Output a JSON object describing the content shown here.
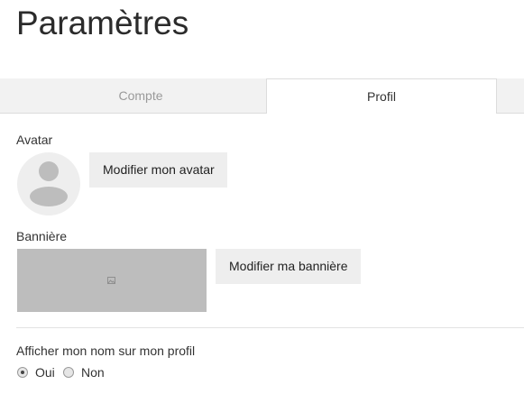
{
  "page": {
    "title": "Paramètres"
  },
  "tabs": [
    {
      "label": "Compte",
      "active": false
    },
    {
      "label": "Profil",
      "active": true
    }
  ],
  "avatar_section": {
    "label": "Avatar",
    "button_label": "Modifier mon avatar",
    "icon": "user-silhouette-icon"
  },
  "banner_section": {
    "label": "Bannière",
    "button_label": "Modifier ma bannière",
    "icon": "image-placeholder-icon"
  },
  "show_name_section": {
    "label": "Afficher mon nom sur mon profil",
    "options": [
      {
        "label": "Oui",
        "checked": true
      },
      {
        "label": "Non",
        "checked": false
      }
    ]
  },
  "colors": {
    "tab_bar_bg": "#f2f2f2",
    "button_bg": "#eeeeee",
    "banner_bg": "#bdbdbd",
    "avatar_bg": "#eeeeee"
  }
}
